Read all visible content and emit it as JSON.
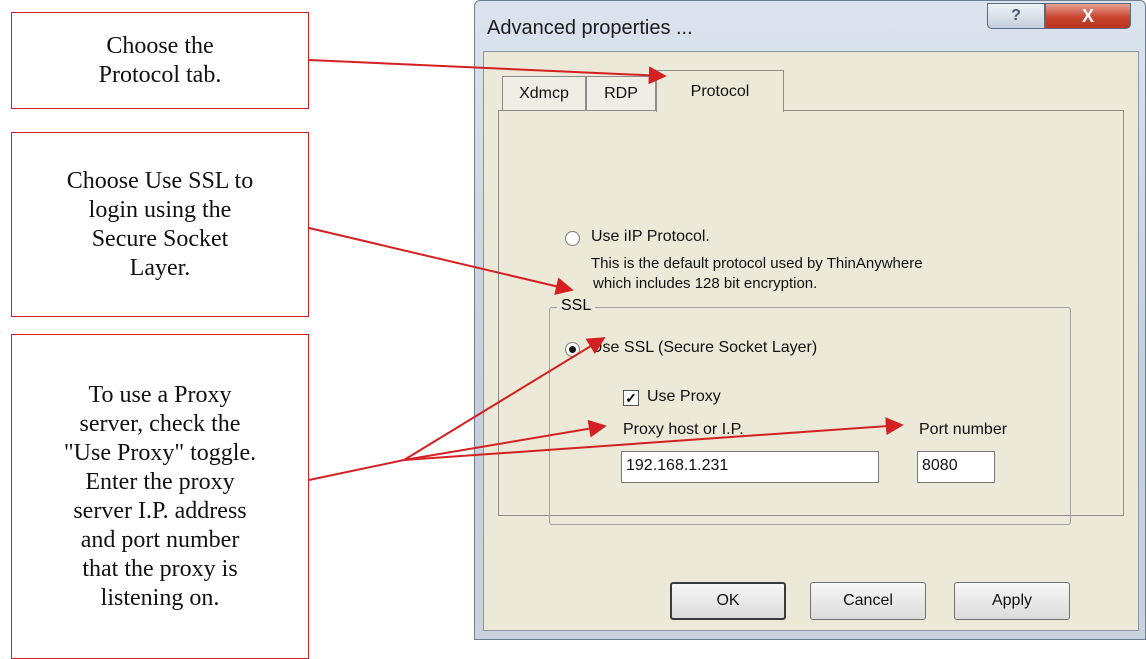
{
  "callouts": [
    {
      "lines": [
        "Choose the",
        "Protocol tab."
      ]
    },
    {
      "lines": [
        "Choose Use SSL to",
        "login using the",
        "Secure Socket",
        "Layer."
      ]
    },
    {
      "lines": [
        "To use a Proxy",
        "server, check the",
        "\"Use Proxy\" toggle.",
        "Enter the proxy",
        "server I.P. address",
        "and port number",
        "that the proxy is",
        "listening on."
      ]
    }
  ],
  "window": {
    "title": "Advanced properties ...",
    "help_label": "?",
    "close_label": "X"
  },
  "tabs": [
    "Xdmcp",
    "RDP",
    "Protocol"
  ],
  "protocol": {
    "ilp_label": "Use iIP Protocol.",
    "ilp_desc_1": "This is the default protocol used by ThinAnywhere",
    "ilp_desc_2": "which includes 128 bit encryption.",
    "ssl_group": "SSL",
    "ssl_label": "Use SSL  (Secure Socket Layer)",
    "proxy_check_label": "Use Proxy",
    "proxy_checked_mark": "✓",
    "proxy_host_label": "Proxy host or I.P.",
    "proxy_host_value": "192.168.1.231",
    "port_label": "Port number",
    "port_value": "8080"
  },
  "buttons": {
    "ok": "OK",
    "cancel": "Cancel",
    "apply": "Apply"
  },
  "colors": {
    "annotation": "#d42020"
  }
}
